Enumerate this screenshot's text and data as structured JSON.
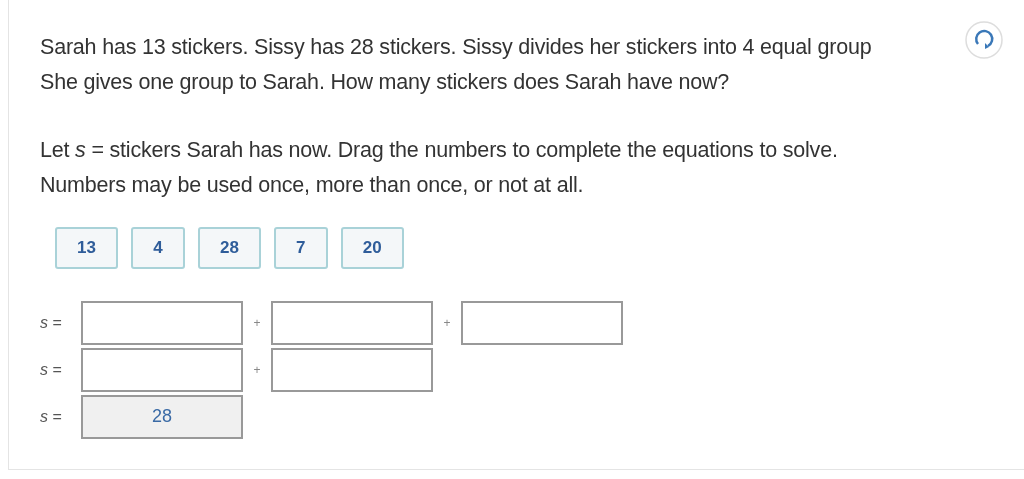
{
  "question": "Sarah has 13 stickers. Sissy has 28 stickers. Sissy divides her stickers into 4 equal group\nShe gives one group to Sarah. How many stickers does Sarah have now?",
  "instruction": "Let *s* = stickers Sarah has now. Drag the numbers to complete the equations to solve.\nNumbers may be used once, more than once, or not at all.",
  "tiles": [
    "13",
    "4",
    "28",
    "7",
    "20"
  ],
  "equations": [
    {
      "variable": "s",
      "equals": "=",
      "operators": [
        "+",
        "+"
      ],
      "slots": [
        {
          "filled": false
        },
        {
          "filled": false
        },
        {
          "filled": false
        }
      ]
    },
    {
      "variable": "s",
      "equals": "=",
      "operators": [
        "+"
      ],
      "slots": [
        {
          "filled": false
        },
        {
          "filled": false
        }
      ]
    },
    {
      "variable": "s",
      "equals": "=",
      "slots": [
        {
          "filled": true,
          "value": "28"
        }
      ]
    }
  ]
}
